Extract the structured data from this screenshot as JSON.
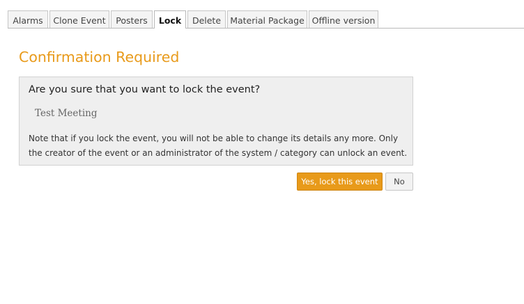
{
  "tabs": [
    {
      "label": "Alarms"
    },
    {
      "label": "Clone Event"
    },
    {
      "label": "Posters"
    },
    {
      "label": "Lock",
      "active": true
    },
    {
      "label": "Delete"
    },
    {
      "label": "Material Package"
    },
    {
      "label": "Offline version"
    }
  ],
  "dialog": {
    "title": "Confirmation Required",
    "question": "Are you sure that you want to lock the event?",
    "event_name": "Test Meeting",
    "note": "Note that if you lock the event, you will not be able to change its details any more. Only the creator of the event or an administrator of the system / category can unlock an event."
  },
  "actions": {
    "confirm_label": "Yes, lock this event",
    "cancel_label": "No"
  },
  "colors": {
    "accent": "#e89a1a",
    "box_background": "#efefef"
  }
}
